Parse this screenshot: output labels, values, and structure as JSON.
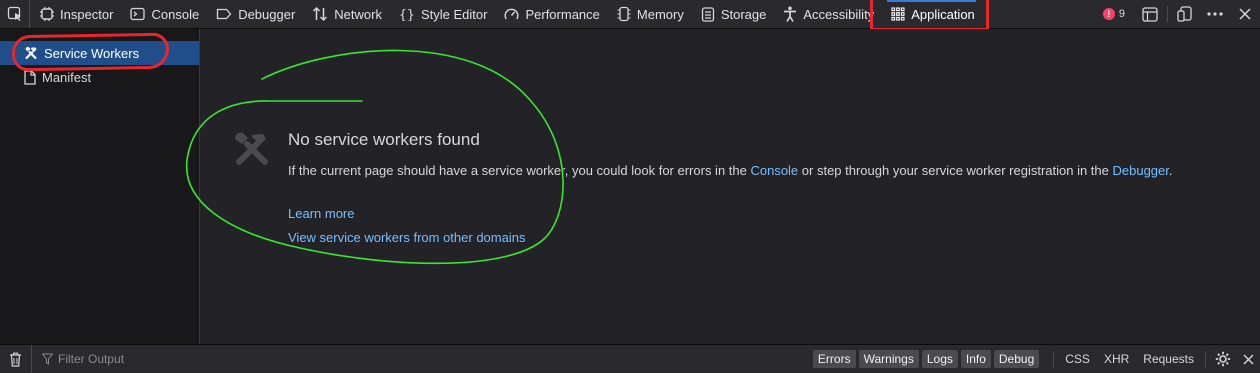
{
  "toolbar": {
    "tabs": [
      {
        "label": "Inspector",
        "icon": "inspector-icon"
      },
      {
        "label": "Console",
        "icon": "console-icon"
      },
      {
        "label": "Debugger",
        "icon": "debugger-icon"
      },
      {
        "label": "Network",
        "icon": "network-icon"
      },
      {
        "label": "Style Editor",
        "icon": "style-editor-icon"
      },
      {
        "label": "Performance",
        "icon": "performance-icon"
      },
      {
        "label": "Memory",
        "icon": "memory-icon"
      },
      {
        "label": "Storage",
        "icon": "storage-icon"
      },
      {
        "label": "Accessibility",
        "icon": "accessibility-icon"
      },
      {
        "label": "Application",
        "icon": "application-icon"
      }
    ],
    "error_count": "9",
    "colors": {
      "accent": "#3a7bd5",
      "annotation_red": "#e8262b",
      "annotation_green": "#38e62e",
      "error": "#ff3f6b"
    }
  },
  "sidebar": {
    "items": [
      {
        "label": "Service Workers",
        "icon": "hammer-wrench-icon"
      },
      {
        "label": "Manifest",
        "icon": "file-icon"
      }
    ]
  },
  "main": {
    "title": "No service workers found",
    "desc_before_console": "If the current page should have a service worker, you could look for errors in the ",
    "console_link": "Console",
    "desc_middle": " or step through your service worker registration in the ",
    "debugger_link": "Debugger",
    "desc_end": ".",
    "learn_more": "Learn more",
    "view_other_domains": "View service workers from other domains"
  },
  "bottombar": {
    "filter_placeholder": "Filter Output",
    "chips": [
      "Errors",
      "Warnings",
      "Logs",
      "Info",
      "Debug"
    ],
    "plain": [
      "CSS",
      "XHR",
      "Requests"
    ]
  }
}
